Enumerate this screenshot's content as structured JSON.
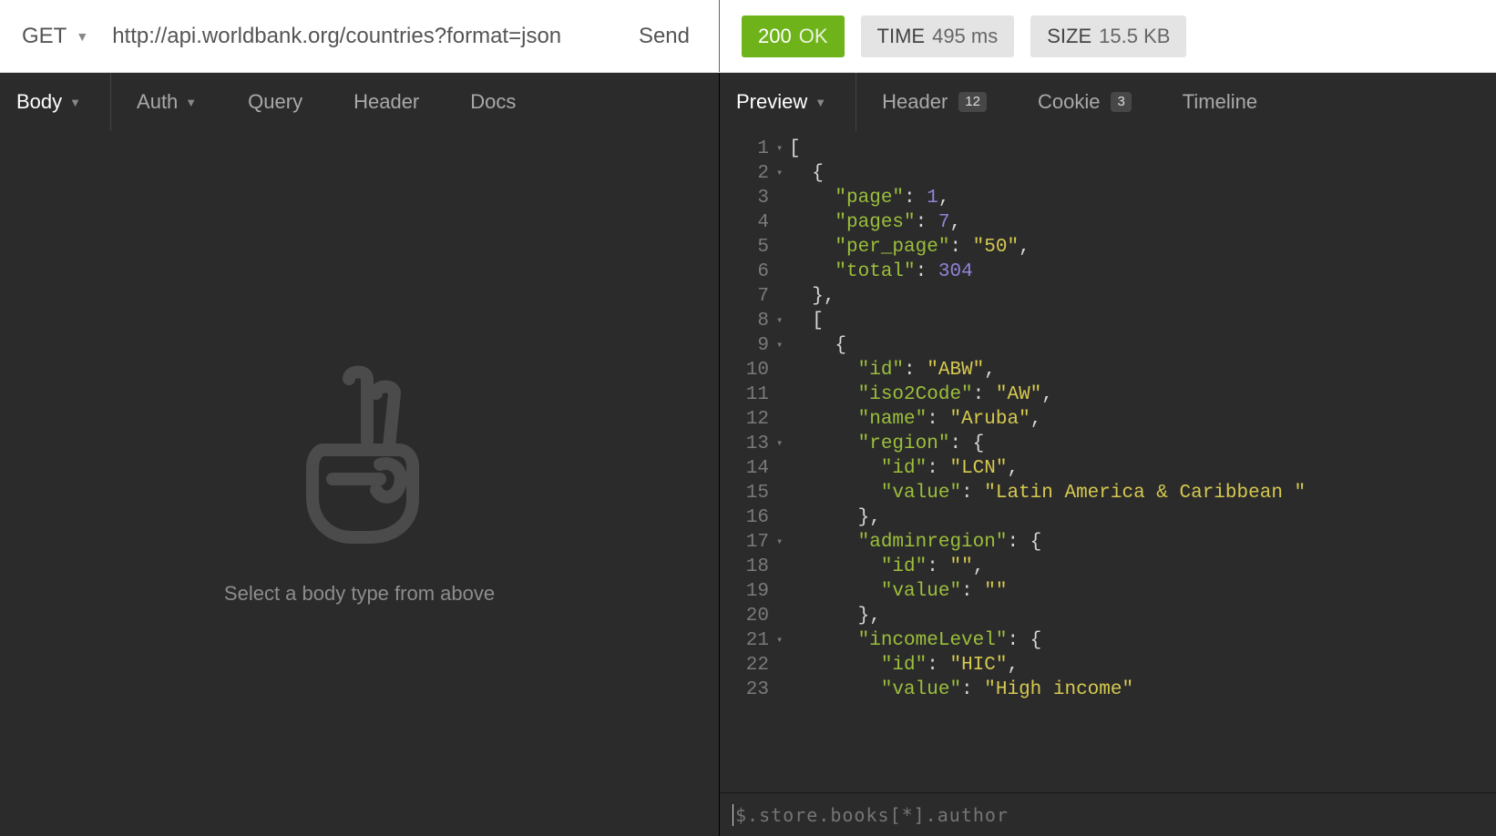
{
  "request": {
    "method": "GET",
    "url": "http://api.worldbank.org/countries?format=json",
    "send_label": "Send"
  },
  "response_meta": {
    "status_code": "200",
    "status_text": "OK",
    "time_label": "TIME",
    "time_value": "495 ms",
    "size_label": "SIZE",
    "size_value": "15.5 KB"
  },
  "left_tabs": {
    "body": "Body",
    "auth": "Auth",
    "query": "Query",
    "header": "Header",
    "docs": "Docs"
  },
  "right_tabs": {
    "preview": "Preview",
    "header": "Header",
    "header_badge": "12",
    "cookie": "Cookie",
    "cookie_badge": "3",
    "timeline": "Timeline"
  },
  "left_body": {
    "placeholder": "Select a body type from above"
  },
  "jsonpath": {
    "placeholder": "$.store.books[*].author"
  },
  "json_lines": [
    {
      "n": 1,
      "fold": "▾",
      "indent": 0,
      "tokens": [
        [
          "punct",
          "["
        ]
      ]
    },
    {
      "n": 2,
      "fold": "▾",
      "indent": 1,
      "tokens": [
        [
          "punct",
          "{"
        ]
      ]
    },
    {
      "n": 3,
      "fold": "",
      "indent": 2,
      "tokens": [
        [
          "key",
          "\"page\""
        ],
        [
          "punct",
          ": "
        ],
        [
          "num",
          "1"
        ],
        [
          "punct",
          ","
        ]
      ]
    },
    {
      "n": 4,
      "fold": "",
      "indent": 2,
      "tokens": [
        [
          "key",
          "\"pages\""
        ],
        [
          "punct",
          ": "
        ],
        [
          "num",
          "7"
        ],
        [
          "punct",
          ","
        ]
      ]
    },
    {
      "n": 5,
      "fold": "",
      "indent": 2,
      "tokens": [
        [
          "key",
          "\"per_page\""
        ],
        [
          "punct",
          ": "
        ],
        [
          "str",
          "\"50\""
        ],
        [
          "punct",
          ","
        ]
      ]
    },
    {
      "n": 6,
      "fold": "",
      "indent": 2,
      "tokens": [
        [
          "key",
          "\"total\""
        ],
        [
          "punct",
          ": "
        ],
        [
          "num",
          "304"
        ]
      ]
    },
    {
      "n": 7,
      "fold": "",
      "indent": 1,
      "tokens": [
        [
          "punct",
          "},"
        ]
      ]
    },
    {
      "n": 8,
      "fold": "▾",
      "indent": 1,
      "tokens": [
        [
          "punct",
          "["
        ]
      ]
    },
    {
      "n": 9,
      "fold": "▾",
      "indent": 2,
      "tokens": [
        [
          "punct",
          "{"
        ]
      ]
    },
    {
      "n": 10,
      "fold": "",
      "indent": 3,
      "tokens": [
        [
          "key",
          "\"id\""
        ],
        [
          "punct",
          ": "
        ],
        [
          "str",
          "\"ABW\""
        ],
        [
          "punct",
          ","
        ]
      ]
    },
    {
      "n": 11,
      "fold": "",
      "indent": 3,
      "tokens": [
        [
          "key",
          "\"iso2Code\""
        ],
        [
          "punct",
          ": "
        ],
        [
          "str",
          "\"AW\""
        ],
        [
          "punct",
          ","
        ]
      ]
    },
    {
      "n": 12,
      "fold": "",
      "indent": 3,
      "tokens": [
        [
          "key",
          "\"name\""
        ],
        [
          "punct",
          ": "
        ],
        [
          "str",
          "\"Aruba\""
        ],
        [
          "punct",
          ","
        ]
      ]
    },
    {
      "n": 13,
      "fold": "▾",
      "indent": 3,
      "tokens": [
        [
          "key",
          "\"region\""
        ],
        [
          "punct",
          ": {"
        ]
      ]
    },
    {
      "n": 14,
      "fold": "",
      "indent": 4,
      "tokens": [
        [
          "key",
          "\"id\""
        ],
        [
          "punct",
          ": "
        ],
        [
          "str",
          "\"LCN\""
        ],
        [
          "punct",
          ","
        ]
      ]
    },
    {
      "n": 15,
      "fold": "",
      "indent": 4,
      "tokens": [
        [
          "key",
          "\"value\""
        ],
        [
          "punct",
          ": "
        ],
        [
          "str",
          "\"Latin America & Caribbean \""
        ]
      ]
    },
    {
      "n": 16,
      "fold": "",
      "indent": 3,
      "tokens": [
        [
          "punct",
          "},"
        ]
      ]
    },
    {
      "n": 17,
      "fold": "▾",
      "indent": 3,
      "tokens": [
        [
          "key",
          "\"adminregion\""
        ],
        [
          "punct",
          ": {"
        ]
      ]
    },
    {
      "n": 18,
      "fold": "",
      "indent": 4,
      "tokens": [
        [
          "key",
          "\"id\""
        ],
        [
          "punct",
          ": "
        ],
        [
          "str",
          "\"\""
        ],
        [
          "punct",
          ","
        ]
      ]
    },
    {
      "n": 19,
      "fold": "",
      "indent": 4,
      "tokens": [
        [
          "key",
          "\"value\""
        ],
        [
          "punct",
          ": "
        ],
        [
          "str",
          "\"\""
        ]
      ]
    },
    {
      "n": 20,
      "fold": "",
      "indent": 3,
      "tokens": [
        [
          "punct",
          "},"
        ]
      ]
    },
    {
      "n": 21,
      "fold": "▾",
      "indent": 3,
      "tokens": [
        [
          "key",
          "\"incomeLevel\""
        ],
        [
          "punct",
          ": {"
        ]
      ]
    },
    {
      "n": 22,
      "fold": "",
      "indent": 4,
      "tokens": [
        [
          "key",
          "\"id\""
        ],
        [
          "punct",
          ": "
        ],
        [
          "str",
          "\"HIC\""
        ],
        [
          "punct",
          ","
        ]
      ]
    },
    {
      "n": 23,
      "fold": "",
      "indent": 4,
      "tokens": [
        [
          "key",
          "\"value\""
        ],
        [
          "punct",
          ": "
        ],
        [
          "str",
          "\"High income\""
        ]
      ]
    }
  ]
}
